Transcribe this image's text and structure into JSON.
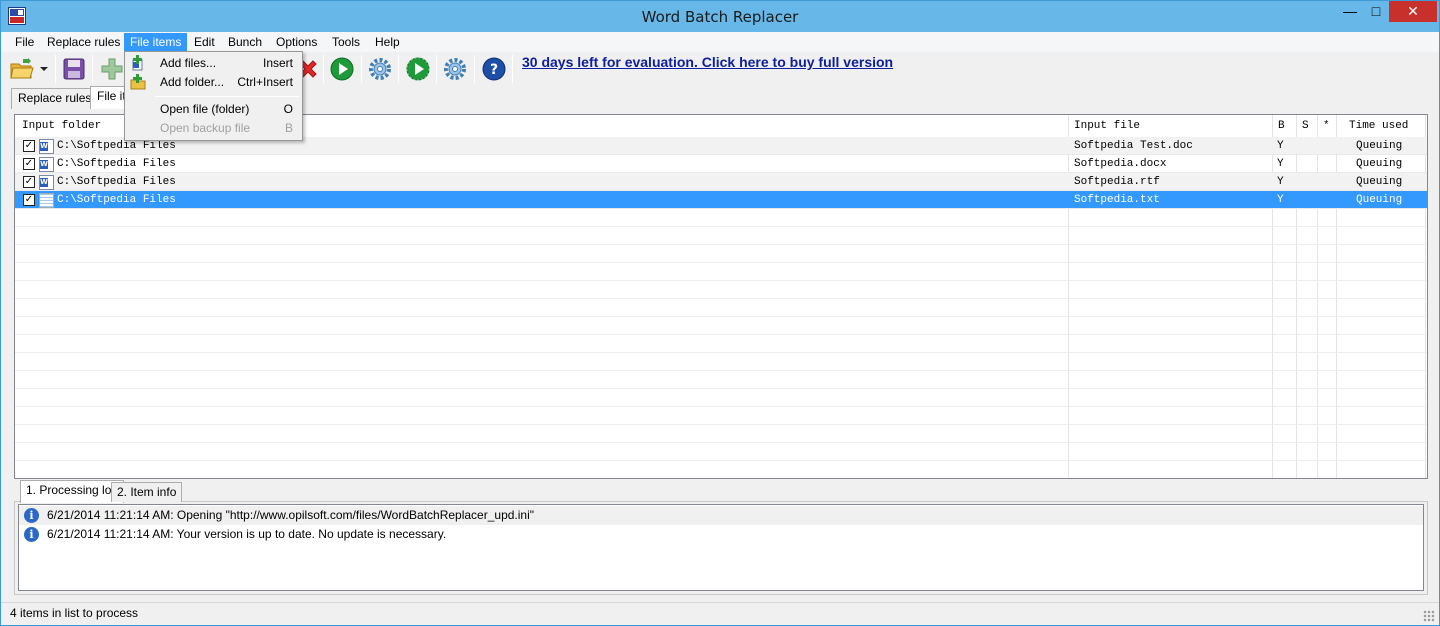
{
  "window": {
    "title": "Word Batch Replacer",
    "minimize": "—",
    "maximize": "□",
    "close": "✕"
  },
  "menubar": {
    "items": [
      "File",
      "Replace rules",
      "File items",
      "Edit",
      "Bunch",
      "Options",
      "Tools",
      "Help"
    ],
    "active": "File items"
  },
  "toolbar": {
    "icons": [
      "open-folder-icon",
      "dropdown-arrow-icon",
      "save-icon",
      "add-icon",
      "delete-icon",
      "run-icon",
      "settings-gear-icon",
      "run-bunch-icon",
      "settings-gear-icon",
      "help-icon"
    ],
    "buy_link": "30 days left for evaluation. Click here to buy full version"
  },
  "main_tabs": [
    "Replace rules",
    "File items"
  ],
  "dropdown": {
    "items": [
      {
        "label": "Add files...",
        "shortcut": "Insert",
        "icon": "add-files-icon",
        "enabled": true
      },
      {
        "label": "Add folder...",
        "shortcut": "Ctrl+Insert",
        "icon": "add-folder-icon",
        "enabled": true
      },
      {
        "label": "Open file (folder)",
        "shortcut": "O",
        "icon": "",
        "enabled": true
      },
      {
        "label": "Open backup file",
        "shortcut": "B",
        "icon": "",
        "enabled": false
      }
    ]
  },
  "file_list": {
    "columns": [
      "Input folder",
      "Input file",
      "B",
      "S",
      "*",
      "Time used"
    ],
    "rows": [
      {
        "checked": true,
        "folder": "C:\\Softpedia Files",
        "file": "Softpedia Test.doc",
        "b": "Y",
        "s": "",
        "star": "",
        "status": "Queuing",
        "icon": "word-doc-icon"
      },
      {
        "checked": true,
        "folder": "C:\\Softpedia Files",
        "file": "Softpedia.docx",
        "b": "Y",
        "s": "",
        "star": "",
        "status": "Queuing",
        "icon": "word-doc-icon"
      },
      {
        "checked": true,
        "folder": "C:\\Softpedia Files",
        "file": "Softpedia.rtf",
        "b": "Y",
        "s": "",
        "star": "",
        "status": "Queuing",
        "icon": "word-doc-icon"
      },
      {
        "checked": true,
        "folder": "C:\\Softpedia Files",
        "file": "Softpedia.txt",
        "b": "Y",
        "s": "",
        "star": "",
        "status": "Queuing",
        "icon": "text-file-icon",
        "selected": true
      }
    ]
  },
  "bottom_tabs": [
    "1. Processing log",
    "2. Item info"
  ],
  "log": [
    {
      "icon": "info-icon",
      "text": "6/21/2014 11:21:14 AM: Opening \"http://www.opilsoft.com/files/WordBatchReplacer_upd.ini\""
    },
    {
      "icon": "info-icon",
      "text": "6/21/2014 11:21:14 AM: Your version is up to date. No update is necessary."
    }
  ],
  "status": {
    "text": "4 items in list to process"
  },
  "colors": {
    "titlebar": "#67b7e9",
    "selection": "#3399ff",
    "link": "#0d1f9e",
    "close_button": "#c7302b"
  }
}
